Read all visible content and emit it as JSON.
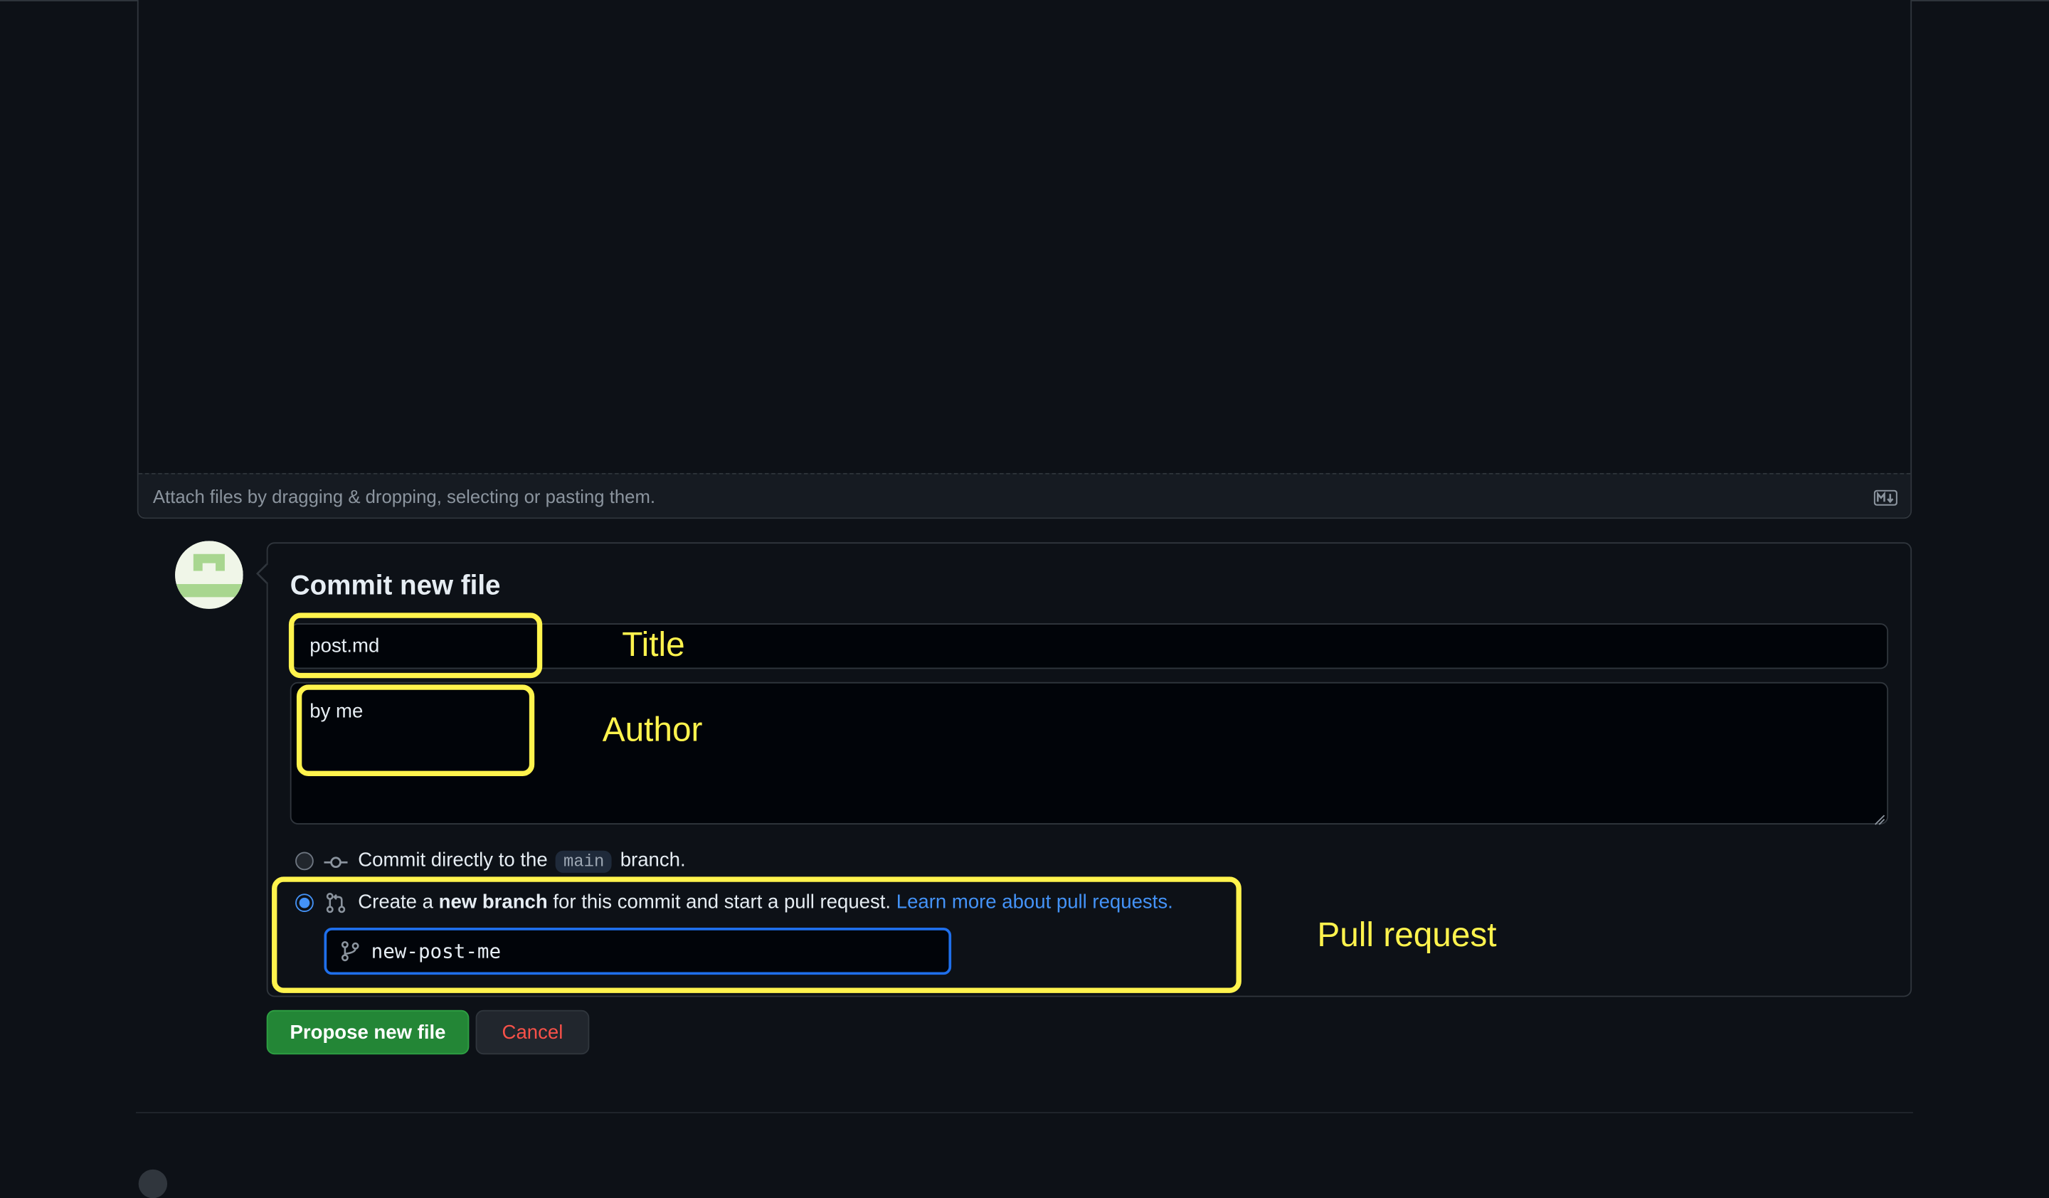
{
  "editor": {
    "attach_hint": "Attach files by dragging & dropping, selecting or pasting them.",
    "markdown_icon": "markdown-icon"
  },
  "commit": {
    "heading": "Commit new file",
    "title_value": "post.md",
    "description_value": "by me",
    "option_direct": {
      "prefix": "Commit directly to the",
      "branch": "main",
      "suffix": "branch.",
      "checked": false
    },
    "option_new_branch": {
      "prefix": "Create a",
      "bold": "new branch",
      "middle": "for this commit and start a pull request.",
      "link": "Learn more about pull requests.",
      "checked": true
    },
    "new_branch_name": "new-post-me",
    "propose_button": "Propose new file",
    "cancel_button": "Cancel"
  },
  "annotations": {
    "title": "Title",
    "author": "Author",
    "pull_request": "Pull request"
  },
  "colors": {
    "background": "#0d1117",
    "primary_button": "#238636",
    "link": "#4493f8",
    "danger": "#f85149",
    "highlight": "#fff34d"
  }
}
